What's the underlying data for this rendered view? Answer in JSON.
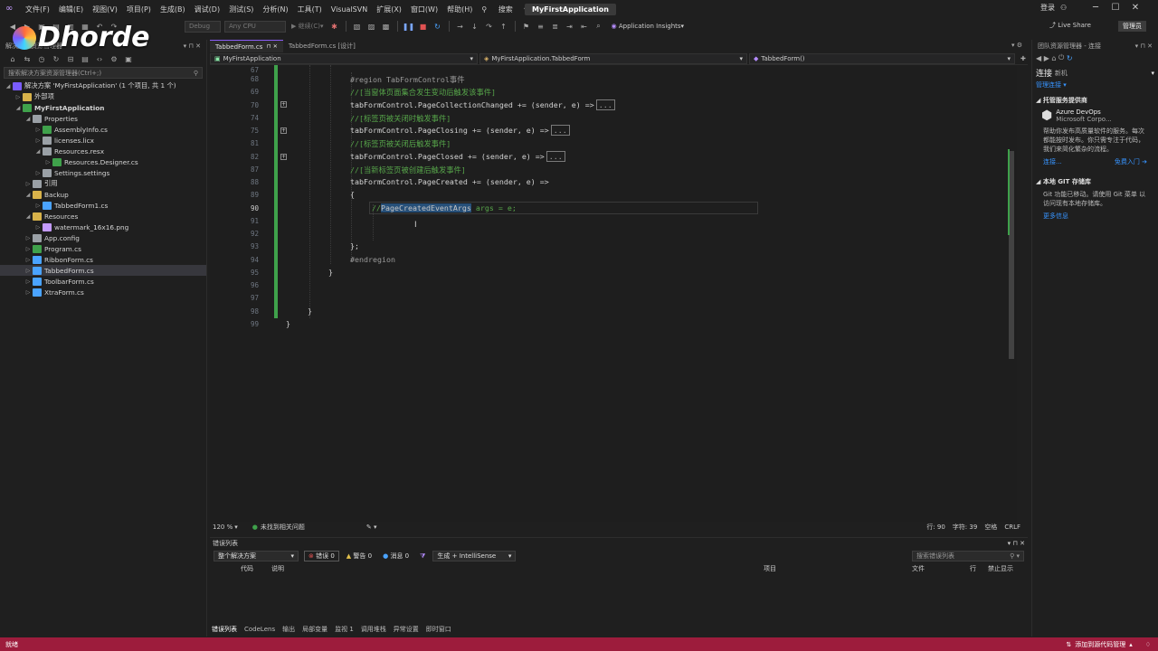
{
  "menu": [
    "文件(F)",
    "编辑(E)",
    "视图(V)",
    "项目(P)",
    "生成(B)",
    "调试(D)",
    "测试(S)",
    "分析(N)",
    "工具(T)",
    "VisualSVN",
    "扩展(X)",
    "窗口(W)",
    "帮助(H)"
  ],
  "search_label": "搜索",
  "app_title": "MyFirstApplication",
  "login": "登录",
  "toolbar": {
    "debug": "Debug",
    "cpu": "Any CPU",
    "continue": "继续(C)",
    "app_insights": "Application Insights",
    "live_share": "Live Share",
    "admin": "管理员"
  },
  "watermark": "Dhorde",
  "solution": {
    "title": "解决方案资源管理器",
    "search_placeholder": "搜索解决方案资源管理器(Ctrl+;)",
    "items": [
      {
        "label": "解决方案 'MyFirstApplication' (1 个项目, 共 1 个)",
        "indent": 0,
        "icon": "solution-icon"
      },
      {
        "label": "外部项",
        "indent": 1,
        "icon": "folder-icon"
      },
      {
        "label": "MyFirstApplication",
        "indent": 1,
        "icon": "csproj-icon",
        "bold": true
      },
      {
        "label": "Properties",
        "indent": 2,
        "icon": "wrench-icon"
      },
      {
        "label": "AssemblyInfo.cs",
        "indent": 3,
        "icon": "cs-icon"
      },
      {
        "label": "licenses.licx",
        "indent": 3,
        "icon": "file-icon"
      },
      {
        "label": "Resources.resx",
        "indent": 3,
        "icon": "resx-icon"
      },
      {
        "label": "Resources.Designer.cs",
        "indent": 4,
        "icon": "cs-icon"
      },
      {
        "label": "Settings.settings",
        "indent": 3,
        "icon": "settings-icon"
      },
      {
        "label": "引用",
        "indent": 2,
        "icon": "reference-icon"
      },
      {
        "label": "Backup",
        "indent": 2,
        "icon": "folder-icon"
      },
      {
        "label": "TabbedForm1.cs",
        "indent": 3,
        "icon": "form-icon"
      },
      {
        "label": "Resources",
        "indent": 2,
        "icon": "folder-icon"
      },
      {
        "label": "watermark_16x16.png",
        "indent": 3,
        "icon": "image-icon"
      },
      {
        "label": "App.config",
        "indent": 2,
        "icon": "config-icon"
      },
      {
        "label": "Program.cs",
        "indent": 2,
        "icon": "cs-icon"
      },
      {
        "label": "RibbonForm.cs",
        "indent": 2,
        "icon": "form-icon"
      },
      {
        "label": "TabbedForm.cs",
        "indent": 2,
        "icon": "form-icon",
        "selected": true
      },
      {
        "label": "ToolbarForm.cs",
        "indent": 2,
        "icon": "form-icon"
      },
      {
        "label": "XtraForm.cs",
        "indent": 2,
        "icon": "form-icon"
      }
    ]
  },
  "editor": {
    "tabs": [
      "TabbedForm.cs",
      "TabbedForm.cs [设计]"
    ],
    "nav": [
      "MyFirstApplication",
      "MyFirstApplication.TabbedForm",
      "TabbedForm()"
    ],
    "line_numbers": [
      "67",
      "68",
      "69",
      "70",
      "74",
      "75",
      "81",
      "82",
      "87",
      "88",
      "89",
      "90",
      "91",
      "92",
      "93",
      "94",
      "95",
      "96",
      "97",
      "98",
      "99"
    ],
    "current_line": "90",
    "lines": {
      "l68": "#region TabFormControl事件",
      "l69": "//[当窗体页面集合发生变动后触发该事件]",
      "l70": "tabFormControl.PageCollectionChanged += (sender, e) =>",
      "l74": "//[标签页被关闭时触发事件]",
      "l75": "tabFormControl.PageClosing += (sender, e) =>",
      "l81": "//[标签页被关闭后触发事件]",
      "l82": "tabFormControl.PageClosed += (sender, e) =>",
      "l87": "//[当新标签页被创建后触发事件]",
      "l88": "tabFormControl.PageCreated += (sender, e) =>",
      "l89": "{",
      "l90_prefix": "//",
      "l90_type": "PageCreatedEventArgs",
      "l90_rest": " args = e;",
      "l93": "};",
      "l94": "#endregion",
      "l95": "}",
      "l98": "}",
      "l99": "}",
      "folded": "..."
    },
    "status": {
      "zoom": "120 %",
      "issues": "未找到相关问题",
      "line": "行: 90",
      "char": "字符: 39",
      "ws": "空格",
      "eol": "CRLF"
    }
  },
  "error_list": {
    "title": "错误列表",
    "scope": "整个解决方案",
    "errors": "错误 0",
    "warnings": "警告 0",
    "messages": "消息 0",
    "build": "生成 + IntelliSense",
    "search": "搜索错误列表",
    "columns": [
      "代码",
      "说明",
      "项目",
      "文件",
      "行",
      "禁止显示"
    ]
  },
  "bottom_tabs": [
    "错误列表",
    "CodeLens",
    "输出",
    "局部变量",
    "监视 1",
    "调用堆栈",
    "异常设置",
    "即时窗口"
  ],
  "team": {
    "title": "团队资源管理器 - 连接",
    "connect": "连接",
    "project": "新机",
    "manage": "管理连接",
    "hosted": "托管服务提供商",
    "azure_title": "Azure DevOps",
    "azure_sub": "Microsoft Corpo...",
    "azure_desc": "帮助你发布高质量软件的服务。每次都能按时发布。你只需专注于代码，我们来简化繁杂的流程。",
    "azure_connect": "连接...",
    "azure_free": "免费入门",
    "git_title": "本地 GIT 存储库",
    "git_desc": "Git 功能已移动。请使用 Git 菜单 以访问现有本地存储库。",
    "git_more": "更多信息"
  },
  "status_bar": {
    "ready": "就绪",
    "source": "添加到源代码管理"
  }
}
